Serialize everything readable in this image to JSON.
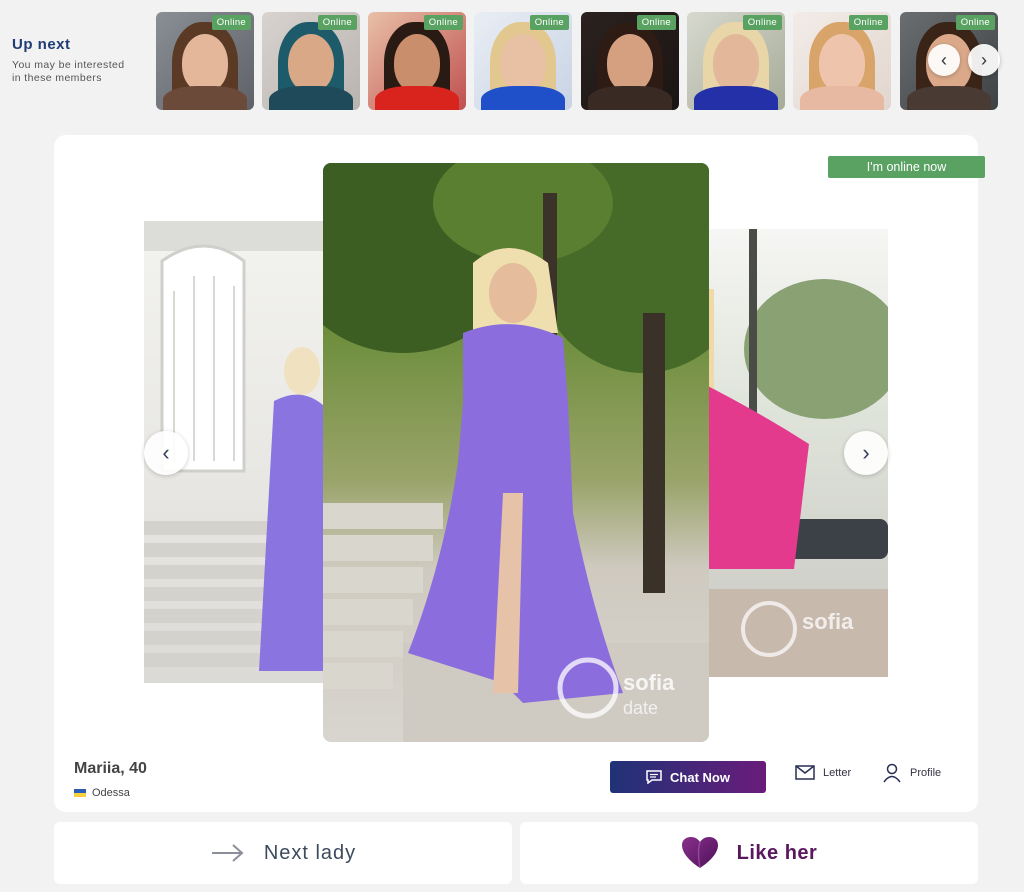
{
  "up_next": {
    "title": "Up next",
    "subtitle_line1": "You may be interested",
    "subtitle_line2": "in these members"
  },
  "thumbnails": [
    {
      "badge": "Online"
    },
    {
      "badge": "Online"
    },
    {
      "badge": "Online"
    },
    {
      "badge": "Online"
    },
    {
      "badge": "Online"
    },
    {
      "badge": "Online"
    },
    {
      "badge": "Online"
    },
    {
      "badge": "Online"
    }
  ],
  "profile": {
    "online_label": "I'm online now",
    "name_age": "Mariia, 40",
    "city": "Odessa"
  },
  "actions": {
    "chat": "Chat Now",
    "letter": "Letter",
    "profile": "Profile"
  },
  "bottom": {
    "next": "Next lady",
    "like": "Like her"
  },
  "watermark": {
    "brand_top": "sofia",
    "brand_bottom": "date"
  },
  "colors": {
    "online_green": "#5aa262",
    "accent_blue": "#1f3c74",
    "chat_gradient_start": "#1f3277",
    "chat_gradient_end": "#6a1c7a",
    "like_purple": "#5a1760"
  }
}
